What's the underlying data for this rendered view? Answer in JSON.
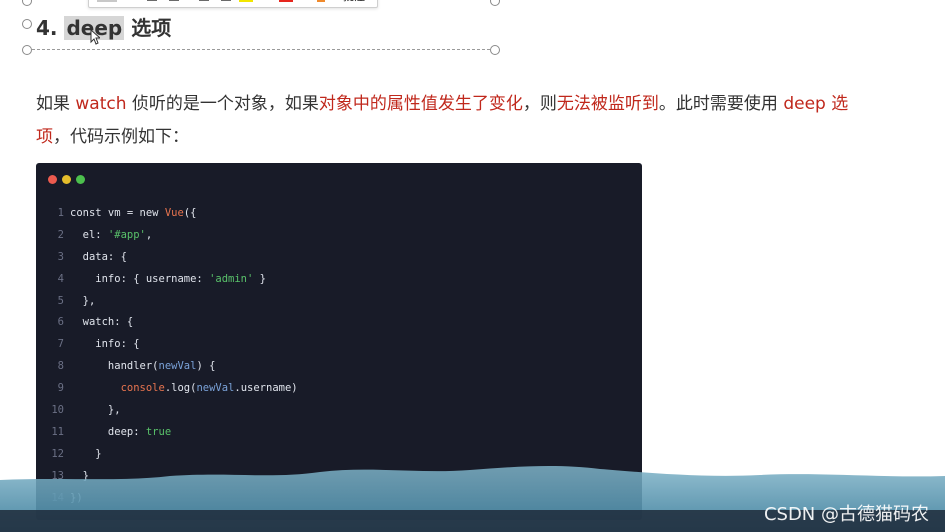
{
  "toolbar": {
    "annotate_label": "批注",
    "colors": {
      "yellow": "#f2e600",
      "red": "#e6261e",
      "orange": "#f08a2c"
    }
  },
  "heading": {
    "number": "4.",
    "keyword": "deep",
    "suffix": "选项"
  },
  "paragraph": {
    "p1": "如果 ",
    "p2": "watch",
    "p3": " 侦听的是一个对象，如果",
    "p4": "对象中的属性值发生了变化",
    "p5": "，则",
    "p6": "无法被监听到",
    "p7": "。此时需要使用 ",
    "p8": "deep",
    "p9": " 选",
    "p10": "项",
    "p11": "，代码示例如下："
  },
  "editor": {
    "dots": [
      "#ec5b4f",
      "#e5bd2b",
      "#4cc04d"
    ],
    "lines": [
      {
        "n": "1",
        "a": "const vm = new ",
        "b": "Vue",
        "c": "({"
      },
      {
        "n": "2",
        "a": "  el: ",
        "s": "'#app'",
        "c": ","
      },
      {
        "n": "3",
        "a": "  data: {"
      },
      {
        "n": "4",
        "a": "    info: { username: ",
        "s": "'admin'",
        "c": " }"
      },
      {
        "n": "5",
        "a": "  },"
      },
      {
        "n": "6",
        "a": "  watch: {"
      },
      {
        "n": "7",
        "a": "    info: {"
      },
      {
        "n": "8",
        "a": "      handler(",
        "p": "newVal",
        "c": ") {"
      },
      {
        "n": "9",
        "a": "        ",
        "f": "console",
        "c": ".log(",
        "p": "newVal",
        "d": ".username)"
      },
      {
        "n": "10",
        "a": "      },"
      },
      {
        "n": "11",
        "a": "      deep: ",
        "t": "true"
      },
      {
        "n": "12",
        "a": "    }"
      },
      {
        "n": "13",
        "a": "  }"
      },
      {
        "n": "14",
        "a": "})"
      }
    ]
  },
  "watermark": "CSDN @古德猫码农"
}
